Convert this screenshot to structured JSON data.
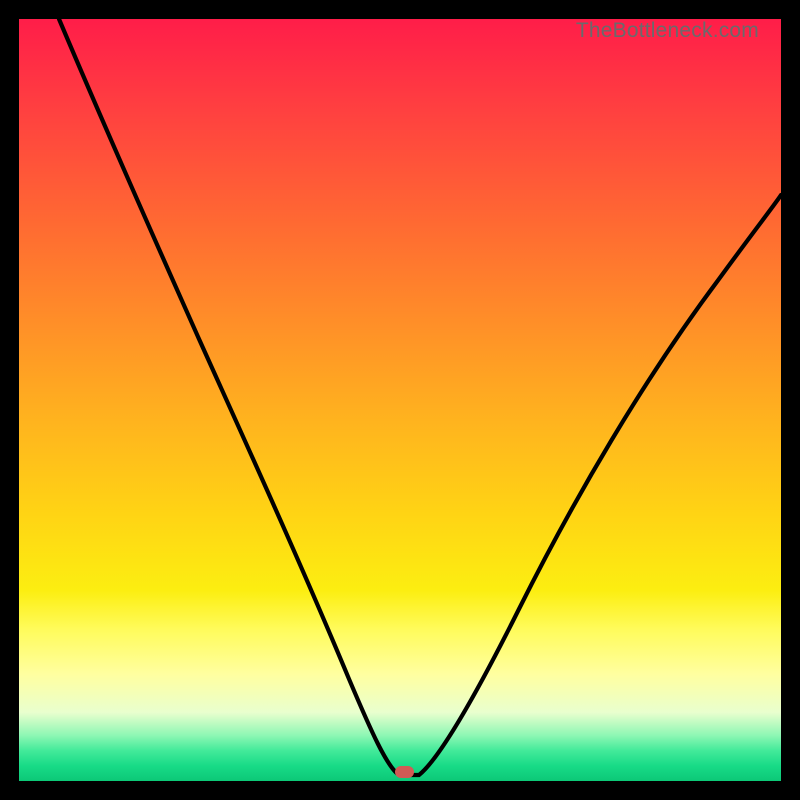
{
  "watermark": "TheBottleneck.com",
  "chart_data": {
    "type": "line",
    "title": "",
    "xlabel": "",
    "ylabel": "",
    "xlim": [
      0,
      100
    ],
    "ylim": [
      0,
      100
    ],
    "x": [
      0,
      6,
      12,
      18,
      24,
      30,
      36,
      42,
      46,
      48,
      50,
      52,
      54,
      58,
      64,
      72,
      82,
      92,
      100
    ],
    "values": [
      100,
      89,
      78,
      67,
      56,
      44,
      32,
      19,
      8,
      2,
      0,
      0,
      2,
      9,
      21,
      37,
      54,
      67,
      75
    ],
    "marker_x": 51,
    "marker_y": 0,
    "grid": false
  },
  "colors": {
    "frame": "#000000",
    "curve": "#000000",
    "marker": "#d25a55"
  }
}
